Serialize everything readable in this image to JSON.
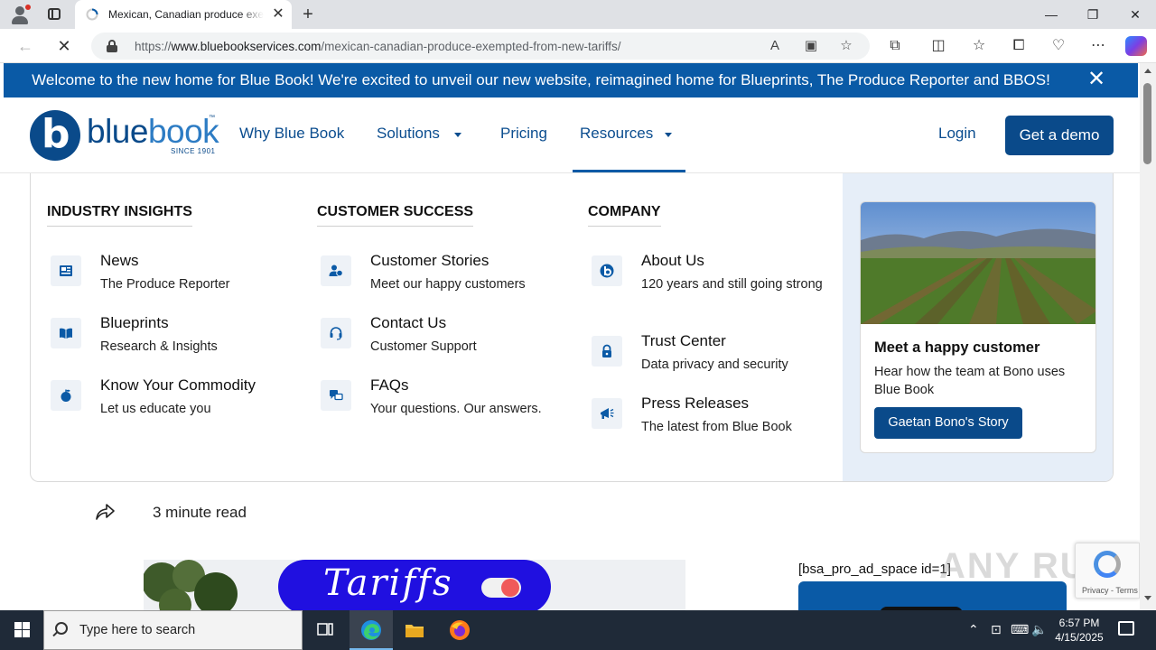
{
  "browser": {
    "tab_title": "Mexican, Canadian produce exempted from new tariffs",
    "tab_close": "✕",
    "new_tab": "+",
    "url_scheme": "https://",
    "url_host": "www.bluebookservices.com",
    "url_path": "/mexican-canadian-produce-exempted-from-new-tariffs/",
    "window_minimize": "—",
    "window_restore": "❐",
    "window_close": "✕"
  },
  "site": {
    "announcement": "Welcome to the new home for Blue Book! We're excited to unveil our new website, reimagined home for Blueprints, The Produce Reporter and BBOS!",
    "announcement_close": "✕",
    "logo": {
      "blue": "blue",
      "book": "book",
      "since": "SINCE 1901",
      "tm": "™",
      "mark": "b"
    },
    "nav": {
      "why": "Why Blue Book",
      "solutions": "Solutions",
      "pricing": "Pricing",
      "resources": "Resources",
      "login": "Login",
      "demo": "Get a demo"
    }
  },
  "menu": {
    "industry": {
      "heading": "INDUSTRY INSIGHTS",
      "items": [
        {
          "title": "News",
          "sub": "The Produce Reporter",
          "icon": "newspaper-icon"
        },
        {
          "title": "Blueprints",
          "sub": "Research & Insights",
          "icon": "book-icon"
        },
        {
          "title": "Know Your Commodity",
          "sub": "Let us educate you",
          "icon": "apple-icon"
        }
      ]
    },
    "customer": {
      "heading": "CUSTOMER SUCCESS",
      "items": [
        {
          "title": "Customer Stories",
          "sub": "Meet our happy customers",
          "icon": "users-icon"
        },
        {
          "title": "Contact Us",
          "sub": "Customer Support",
          "icon": "headset-icon"
        },
        {
          "title": "FAQs",
          "sub": "Your questions. Our answers.",
          "icon": "chat-icon"
        }
      ]
    },
    "company": {
      "heading": "COMPANY",
      "items": [
        {
          "title": "About Us",
          "sub": "120 years and still going strong",
          "icon": "bluebook-logo-icon"
        },
        {
          "title": "Trust Center",
          "sub": "Data privacy and security",
          "icon": "lock-icon"
        },
        {
          "title": "Press Releases",
          "sub": "The latest from Blue Book",
          "icon": "megaphone-icon"
        }
      ]
    },
    "promo": {
      "title": "Meet a happy customer",
      "text": "Hear how the team at Bono uses Blue Book",
      "button": "Gaetan Bono's Story"
    }
  },
  "article": {
    "read_time": "3 minute read",
    "hero_word": "Tariffs",
    "ad_label": "[bsa_pro_ad_space id=1]",
    "watermark": "ANY RUN",
    "recaptcha": "Privacy - Terms"
  },
  "taskbar": {
    "search_placeholder": "Type here to search",
    "time": "6:57 PM",
    "date": "4/15/2025"
  },
  "colors": {
    "brand_dark": "#0a4a8a",
    "brand": "#0a5aa6",
    "menu_panel": "#e6eef8",
    "taskbar": "#1f2a38"
  }
}
